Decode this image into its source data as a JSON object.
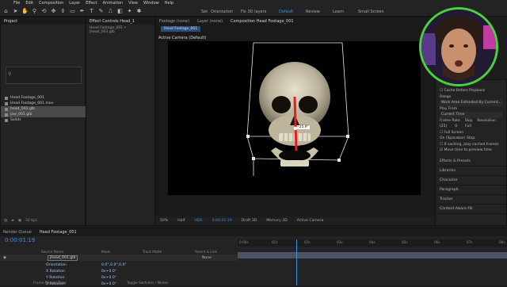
{
  "menu": [
    "File",
    "Edit",
    "Composition",
    "Layer",
    "Effect",
    "Animation",
    "View",
    "Window",
    "Help"
  ],
  "toolbar": {
    "snap_label": "Set",
    "orientation_label": "Orientation",
    "layers_label": "Fix 3D layers",
    "workspaces": [
      "Default",
      "Review",
      "Learn",
      "Small Screen"
    ],
    "active_workspace": "Default"
  },
  "project": {
    "tab": "Project",
    "items": [
      {
        "name": "Head Footage_001",
        "type": "comp",
        "selected": false
      },
      {
        "name": "Head Footage_001.mov",
        "type": "file",
        "selected": false
      },
      {
        "name": "head_001.glb",
        "type": "file",
        "selected": true
      },
      {
        "name": "jaw_001.glb",
        "type": "file",
        "selected": true
      },
      {
        "name": "Solids",
        "type": "folder",
        "selected": false
      }
    ]
  },
  "effect_controls": {
    "tab": "Effect Controls Head_1",
    "sub": "Head Footage_001 • jhead_003.glb"
  },
  "comp_panel": {
    "tabs": [
      "Footage (none)",
      "Layer (none)",
      "Composition Head Footage_001"
    ],
    "breadcrumb": "Head Footage_001",
    "camera_label": "Active Camera (Default)",
    "gizmo_label": "-25.9°"
  },
  "viewer_bar": {
    "zoom": "50%",
    "quality": "Half",
    "timecode": "0:00:01:19",
    "hdr": "HDR",
    "renderer": "Draft 3D",
    "engine": "Mercury 3D",
    "view": "Active Camera"
  },
  "right_panel": {
    "cache": "Cache Before Playback",
    "range_label": "Range",
    "range_value": "Work Area Extended By Current...",
    "play_from_label": "Play From",
    "play_from_value": "Current Time",
    "frame_rate_label": "Frame Rate",
    "skip_label": "Skip",
    "resolution_label": "Resolution",
    "frame_rate_value": "(25)",
    "skip_value": "0",
    "resolution_value": "Full",
    "full_screen": "Full Screen",
    "spacebar_stop": "On (Spacebar) Stop:",
    "if_caching": "If caching, play cached frames",
    "move_time": "Move time to preview time",
    "sections": [
      "Effects & Presets",
      "Libraries",
      "Character",
      "Paragraph",
      "Tracker",
      "Content-Aware Fill"
    ]
  },
  "timeline": {
    "tabs": [
      "Render Queue",
      "Head Footage_001"
    ],
    "timecode": "0:00:01:19",
    "bit_depth": "32 bpc",
    "columns": [
      "Source Name",
      "Mode",
      "Track Matte",
      "Parent & Link"
    ],
    "layer_name": "jhead_001.glb",
    "layer_parent": "None",
    "props": [
      {
        "name": "Orientation",
        "value": "0.0°,0.0°,0.0°"
      },
      {
        "name": "X Rotation",
        "value": "0x+0.0°"
      },
      {
        "name": "Y Rotation",
        "value": "0x+0.0°"
      },
      {
        "name": "Z Rotation",
        "value": "0x+0.0°"
      }
    ],
    "footer_left": "Frame Render Time",
    "footer_mid": "Toggle Switches / Modes",
    "ruler_labels": [
      "0:00s",
      "01s",
      "02s",
      "03s",
      "04s",
      "05s",
      "06s",
      "07s",
      "08s"
    ],
    "playhead_seconds": 1.76
  }
}
